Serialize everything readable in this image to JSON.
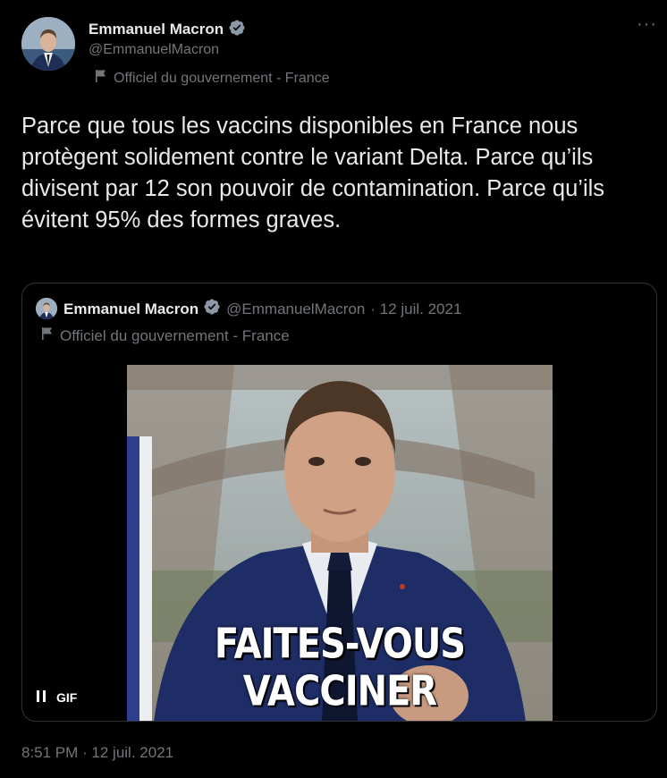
{
  "author": {
    "name": "Emmanuel Macron",
    "handle": "@EmmanuelMacron",
    "affiliation": "Officiel du gouvernement - France"
  },
  "tweet": {
    "text": "Parce que tous les vaccins disponibles en France nous protègent solidement contre le variant Delta. Parce qu’ils divisent par 12 son pouvoir de contamination. Parce qu’ils évitent 95% des formes graves.",
    "timestamp": "8:51 PM · 12 juil. 2021"
  },
  "quoted": {
    "name": "Emmanuel Macron",
    "handle": "@EmmanuelMacron",
    "date": "· 12 juil. 2021",
    "affiliation": "Officiel du gouvernement - France",
    "media": {
      "caption": "FAITES-VOUS VACCINER",
      "badge": "GIF"
    }
  },
  "icons": [
    "verified-badge-icon",
    "flag-icon",
    "more-icon",
    "pause-icon"
  ],
  "colors": {
    "background": "#000000",
    "text": "#e7e9ea",
    "muted": "#71767b",
    "border": "#2f3336",
    "verified": "#8b98a5"
  }
}
